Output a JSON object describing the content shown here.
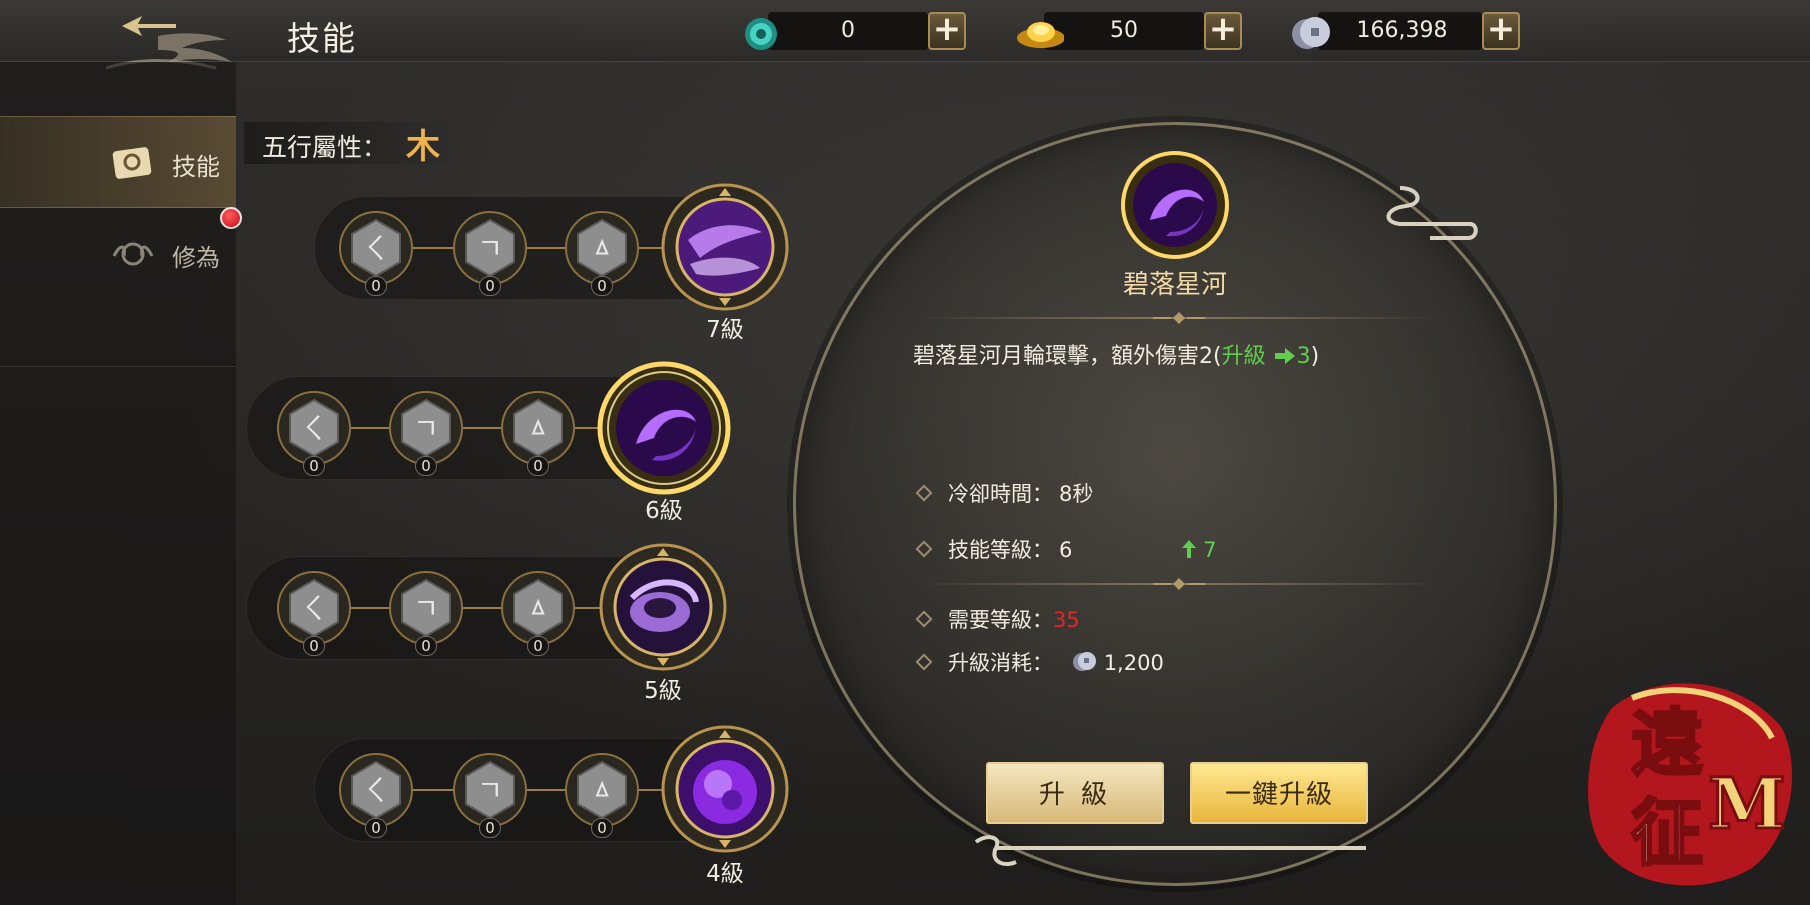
{
  "header": {
    "title": "技能"
  },
  "currencies": [
    {
      "icon": "jade-coin-icon",
      "value": "0"
    },
    {
      "icon": "gold-ingot-icon",
      "value": "50"
    },
    {
      "icon": "silver-coin-icon",
      "value": "166,398"
    }
  ],
  "sidebar": {
    "items": [
      {
        "label": "技能",
        "icon": "skill-book-icon",
        "active": true
      },
      {
        "label": "修為",
        "icon": "cultivation-icon",
        "active": false
      }
    ]
  },
  "element": {
    "label": "五行屬性：",
    "value": "木"
  },
  "skill_rows": [
    {
      "runes": [
        {
          "glyph": "ㄑ",
          "count": "0"
        },
        {
          "glyph": "ㄱ",
          "count": "0"
        },
        {
          "glyph": "ㅿ",
          "count": "0"
        }
      ],
      "level": "7級",
      "orb": "purple-swirl"
    },
    {
      "runes": [
        {
          "glyph": "ㄑ",
          "count": "0"
        },
        {
          "glyph": "ㄱ",
          "count": "0"
        },
        {
          "glyph": "ㅿ",
          "count": "0"
        }
      ],
      "level": "6級",
      "orb": "purple-moon",
      "selected": true
    },
    {
      "runes": [
        {
          "glyph": "ㄑ",
          "count": "0"
        },
        {
          "glyph": "ㄱ",
          "count": "0"
        },
        {
          "glyph": "ㅿ",
          "count": "0"
        }
      ],
      "level": "5級",
      "orb": "purple-ring"
    },
    {
      "runes": [
        {
          "glyph": "ㄑ",
          "count": "0"
        },
        {
          "glyph": "ㄱ",
          "count": "0"
        },
        {
          "glyph": "ㅿ",
          "count": "0"
        }
      ],
      "level": "4級",
      "orb": "purple-sphere"
    }
  ],
  "detail": {
    "name": "碧落星河",
    "desc_main": "碧落星河月輪環擊，額外傷害2(",
    "desc_upgrade": "升級",
    "desc_next": "3",
    "desc_close": ")",
    "cooldown_label": "冷卻時間：",
    "cooldown_value": "8秒",
    "level_label": "技能等級：",
    "level_value": "6",
    "level_next": "7",
    "req_label": "需要等級：",
    "req_value": "35",
    "cost_label": "升級消耗：",
    "cost_value": "1,200",
    "upgrade_button": "升 級",
    "one_key_button": "一鍵升級"
  },
  "logo": {
    "text_top": "遠",
    "text_bottom": "征",
    "text_m": "M"
  },
  "colors": {
    "accent_gold": "#c9a25a",
    "upgrade_green": "#5fce4e",
    "warning_red": "#e3252a",
    "orb_purple": "#8a2be2"
  }
}
